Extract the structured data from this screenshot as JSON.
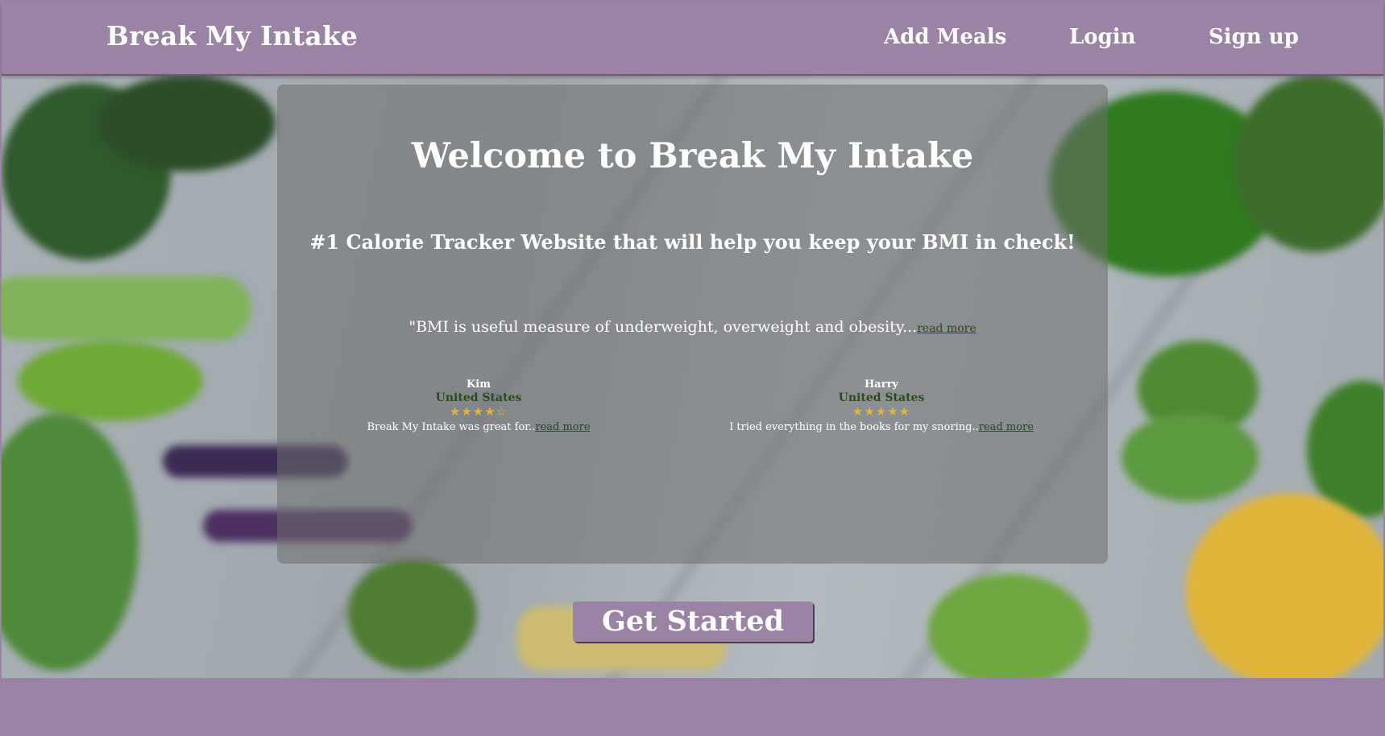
{
  "nav": {
    "brand": "Break My Intake",
    "links": [
      "Add Meals",
      "Login",
      "Sign up"
    ]
  },
  "hero": {
    "title": "Welcome to Break My Intake",
    "subtitle": "#1 Calorie Tracker Website that will help you keep your BMI in check!",
    "quote": "\"BMI is useful measure of underweight, overweight and obesity...",
    "quote_link": "read more"
  },
  "reviews": [
    {
      "name": "Kim",
      "country": "United States",
      "stars": "★★★★☆",
      "rating": 4,
      "text": "Break My Intake was great for..",
      "link": "read more"
    },
    {
      "name": "Harry",
      "country": "United States",
      "stars": "★★★★★",
      "rating": 5,
      "text": "I tried everything in the books for my snoring..",
      "link": "read more"
    }
  ],
  "cta": {
    "label": "Get Started"
  },
  "colors": {
    "brand_purple": "#9b83a5",
    "link_green": "#25461f",
    "star_gold": "#e1b33f"
  }
}
